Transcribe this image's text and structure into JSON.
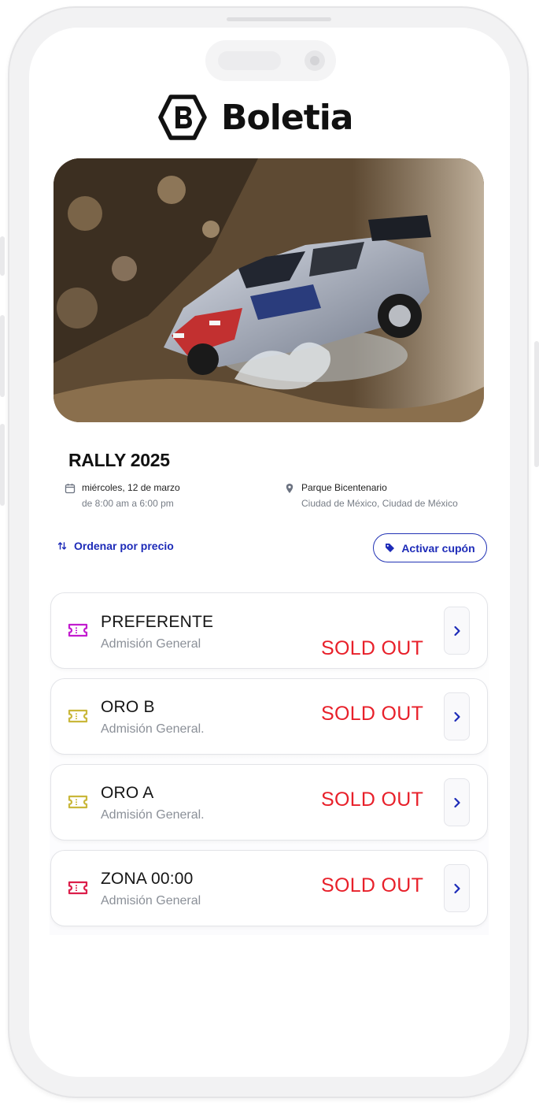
{
  "app": {
    "brand_name": "Boletia"
  },
  "event": {
    "title": "RALLY 2025",
    "date": "miércoles, 12 de marzo",
    "time": "de 8:00 am a 6:00 pm",
    "venue": "Parque Bicentenario",
    "city": "Ciudad de México, Ciudad de México"
  },
  "controls": {
    "sort_label": "Ordenar por precio",
    "coupon_label": "Activar cupón"
  },
  "tickets": [
    {
      "name": "PREFERENTE",
      "description": "Admisión General",
      "status": "SOLD OUT",
      "icon_color": "#c21ccf"
    },
    {
      "name": "ORO B",
      "description": "Admisión General.",
      "status": "SOLD OUT",
      "icon_color": "#c9b73a"
    },
    {
      "name": "ORO A",
      "description": "Admisión General.",
      "status": "SOLD OUT",
      "icon_color": "#c9b73a"
    },
    {
      "name": "ZONA 00:00",
      "description": "Admisión General",
      "status": "SOLD OUT",
      "icon_color": "#dc1e4a"
    }
  ],
  "colors": {
    "accent": "#1d2bb8",
    "sold_out": "#e8202a",
    "muted_text": "#8b9098"
  },
  "icons": {
    "logo": "b-hexagon-logo",
    "date": "calendar-icon",
    "location": "map-pin-icon",
    "sort": "sort-arrows-icon",
    "coupon": "tag-icon",
    "ticket": "ticket-icon",
    "next": "chevron-right-icon"
  }
}
